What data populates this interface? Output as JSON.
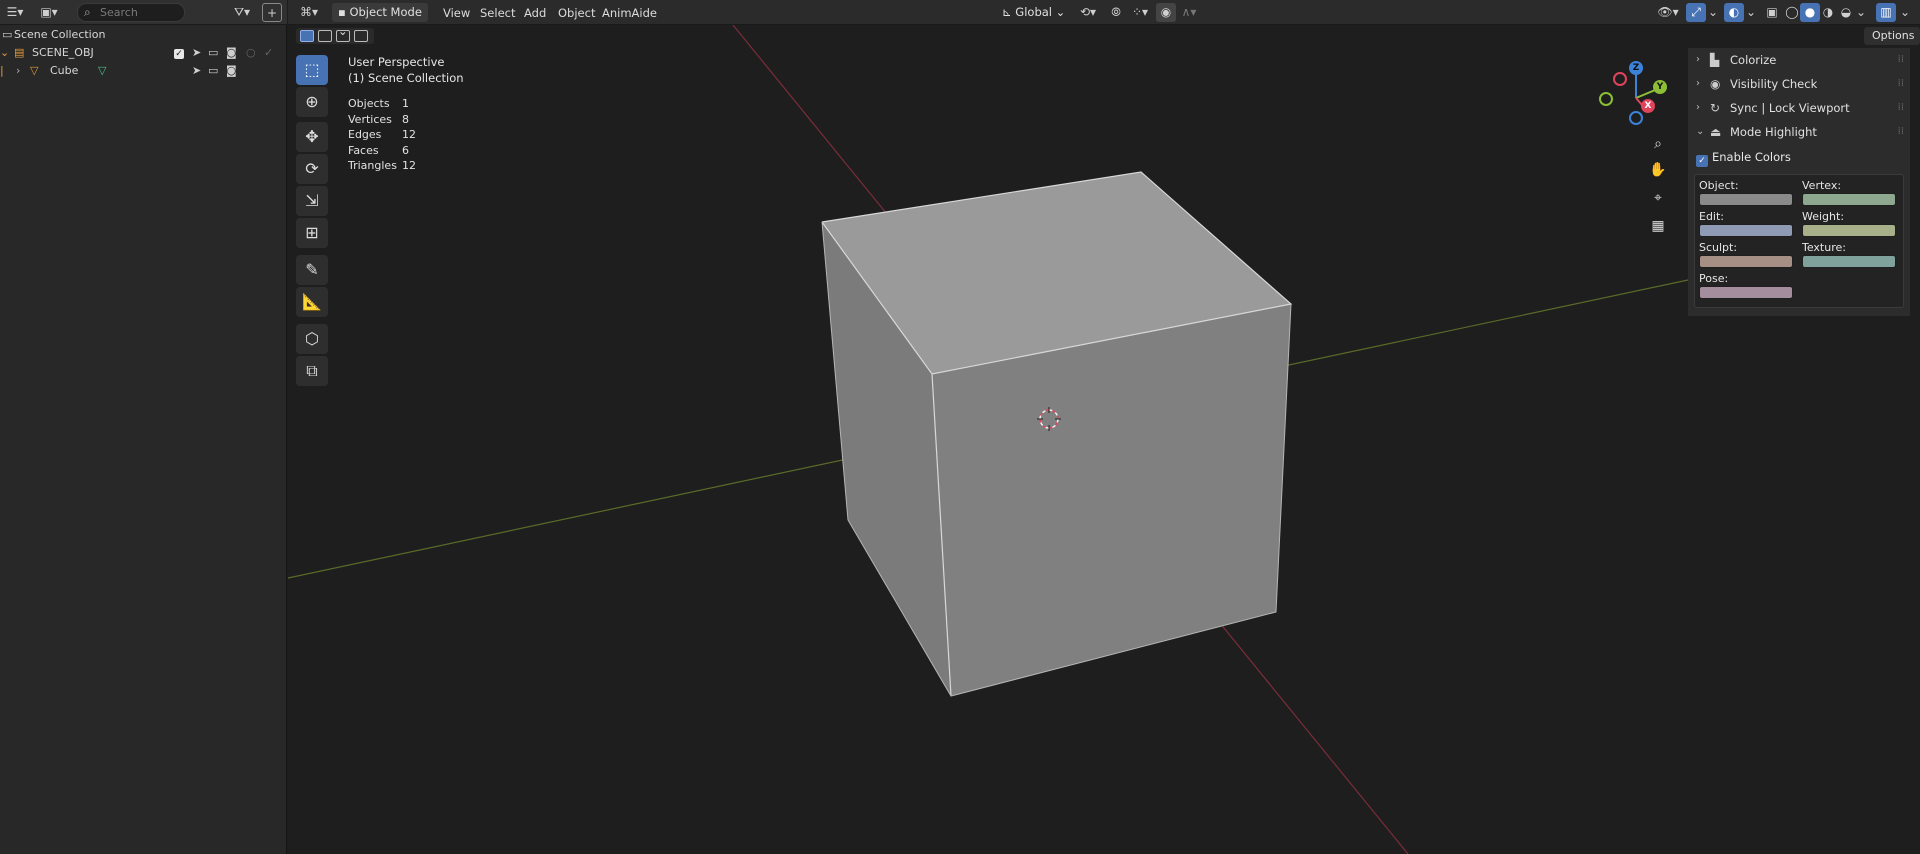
{
  "outliner": {
    "search_placeholder": "Search",
    "rows": [
      {
        "label": "Scene Collection"
      },
      {
        "label": "SCENE_OBJ"
      },
      {
        "label": "Cube"
      }
    ]
  },
  "viewport": {
    "mode": "Object Mode",
    "menus": [
      "View",
      "Select",
      "Add",
      "Object",
      "AnimAide"
    ],
    "orientation": "Global",
    "options_label": "Options",
    "perspective": "User Perspective",
    "collection": "(1) Scene Collection",
    "stats": [
      {
        "key": "Objects",
        "value": "1"
      },
      {
        "key": "Vertices",
        "value": "8"
      },
      {
        "key": "Edges",
        "value": "12"
      },
      {
        "key": "Faces",
        "value": "6"
      },
      {
        "key": "Triangles",
        "value": "12"
      }
    ],
    "gizmo": {
      "z": "Z",
      "y": "Y",
      "x": "X"
    }
  },
  "npanel": {
    "sections": [
      "Colorize",
      "Visibility Check",
      "Sync | Lock Viewport",
      "Mode Highlight"
    ],
    "enable_label": "Enable Colors",
    "swatches": [
      {
        "label": "Object:",
        "color": "#8a8a8a"
      },
      {
        "label": "Vertex:",
        "color": "#8da88f"
      },
      {
        "label": "Edit:",
        "color": "#8f9bb5"
      },
      {
        "label": "Weight:",
        "color": "#a8b08a"
      },
      {
        "label": "Sculpt:",
        "color": "#a68f85"
      },
      {
        "label": "Texture:",
        "color": "#7fa39c"
      },
      {
        "label": "Pose:",
        "color": "#a48e9e"
      }
    ]
  },
  "colors": {
    "accent": "#4772b3",
    "x_axis": "#e0435c",
    "y_axis": "#8cbf36",
    "z_axis": "#3c82d8"
  }
}
